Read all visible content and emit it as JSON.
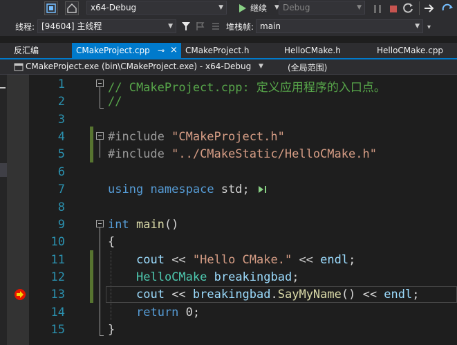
{
  "toolbar1": {
    "config_combo": "x64-Debug",
    "continue_label": "继续",
    "debug_combo": "Debug"
  },
  "toolbar2": {
    "thread_label": "线程:",
    "thread_value": "[94604] 主线程",
    "stackframe_label": "堆栈帧:",
    "stackframe_value": "main"
  },
  "tabs": {
    "disassembly": "反汇编",
    "active": "CMakeProject.cpp",
    "pin": "⊸",
    "close": "×",
    "t2": "CMakeProject.h",
    "t3": "HelloCMake.h",
    "t4": "HelloCMake.cpp"
  },
  "navbar": {
    "project": "CMakeProject.exe (bin\\CMakeProject.exe) - x64-Debug",
    "scope": "(全局范围)"
  },
  "editor": {
    "line_numbers": [
      "1",
      "2",
      "3",
      "4",
      "5",
      "6",
      "7",
      "8",
      "9",
      "10",
      "11",
      "12",
      "13",
      "14",
      "15"
    ],
    "l1": "// CMakeProject.cpp: 定义应用程序的入口点。",
    "l2": "//",
    "l4_pp": "#include ",
    "l4_str": "\"CMakeProject.h\"",
    "l5_pp": "#include ",
    "l5_str": "\"../CMakeStatic/HelloCMake.h\"",
    "l7_kw1": "using",
    "l7_kw2": "namespace",
    "l7_rest": " std;",
    "l9_kw": "int",
    "l9_fn": "main",
    "l9_rest": "()",
    "l10": "{",
    "l11_a": "cout",
    "l11_b": " << ",
    "l11_str": "\"Hello CMake.\"",
    "l11_c": " << ",
    "l11_d": "endl",
    "l11_e": ";",
    "l12_ty": "HelloCMake",
    "l12_id": "breakingbad",
    "l12_e": ";",
    "l13_a": "cout",
    "l13_b": " << ",
    "l13_id": "breakingbad",
    "l13_dot": ".",
    "l13_fn": "SayMyName",
    "l13_c": "() << ",
    "l13_d": "endl",
    "l13_e": ";",
    "l14_kw": "return",
    "l14_rest": " 0;",
    "l15": "}"
  },
  "colors": {
    "accent": "#007acc",
    "breakpoint": "#e51400",
    "exec_arrow": "#f5d20b",
    "change_bar": "#577430"
  }
}
